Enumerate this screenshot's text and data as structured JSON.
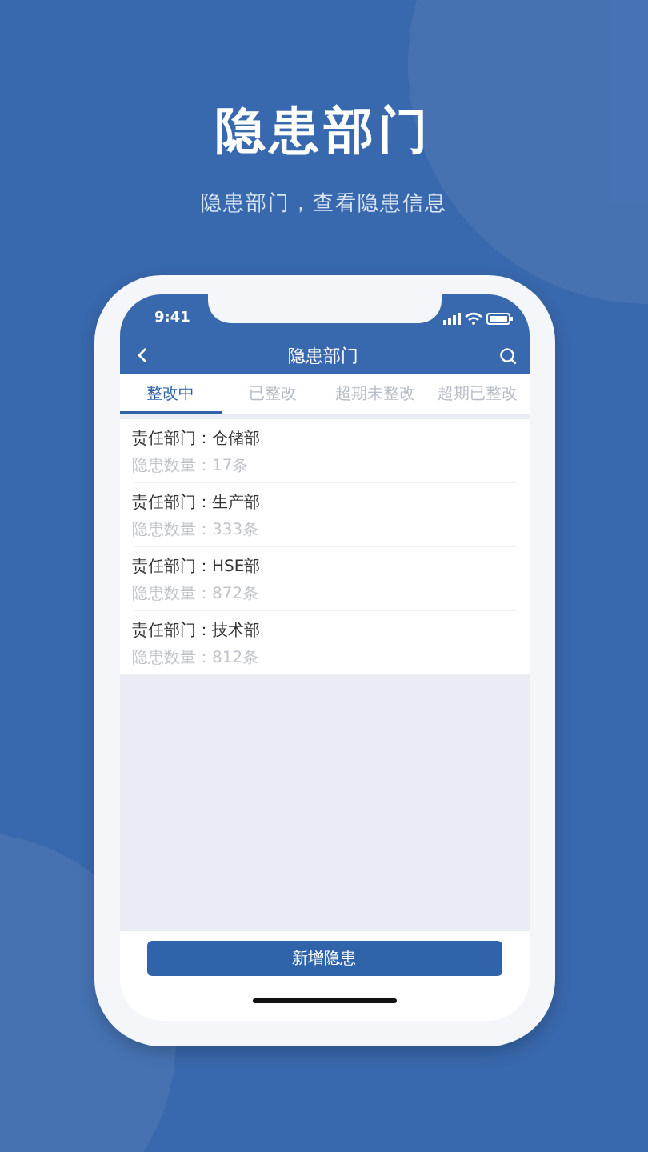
{
  "headline": "隐患部门",
  "subtitle": "隐患部门，查看隐患信息",
  "status_bar": {
    "time": "9:41"
  },
  "nav": {
    "title": "隐患部门"
  },
  "tabs": [
    {
      "label": "整改中",
      "selected": true
    },
    {
      "label": "已整改",
      "selected": false
    },
    {
      "label": "超期未整改",
      "selected": false
    },
    {
      "label": "超期已整改",
      "selected": false
    }
  ],
  "departments": [
    {
      "label": "责任部门：仓储部",
      "count": "隐患数量：17条"
    },
    {
      "label": "责任部门：生产部",
      "count": "隐患数量：333条"
    },
    {
      "label": "责任部门：HSE部",
      "count": "隐患数量：872条"
    },
    {
      "label": "责任部门：技术部",
      "count": "隐患数量：812条"
    }
  ],
  "button": "新增隐患"
}
